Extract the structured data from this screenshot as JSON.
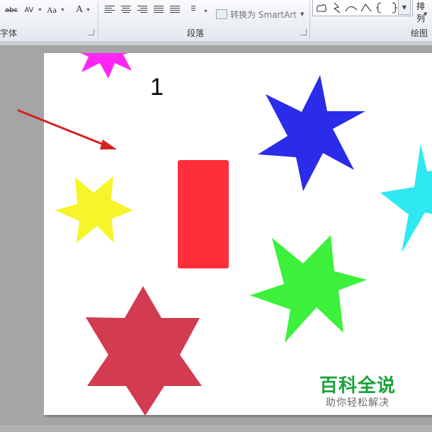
{
  "ribbon": {
    "font_group_label": "字体",
    "paragraph_group_label": "段落",
    "drawing_group_label": "绘图",
    "convert_smartart_label": "转换为 SmartArt",
    "arrange_label": "排列",
    "strikethrough_label": "abc",
    "spacing_label": "AV",
    "case_label": "Aa",
    "font_color_label": "A"
  },
  "slide": {
    "number_label": "1"
  },
  "shapes": {
    "magenta_star_color": "#ff26f5",
    "blue_star_color": "#2b2bea",
    "cyan_star_color": "#2ee8f2",
    "yellow_star_color": "#f5f52a",
    "green_star_color": "#3cf03c",
    "crimson_star_color": "#d23b50",
    "rectangle_color": "#fe2e3a",
    "arrow_color": "#d42222"
  },
  "watermark": {
    "title": "百科全说",
    "subtitle": "助你轻松解决"
  }
}
